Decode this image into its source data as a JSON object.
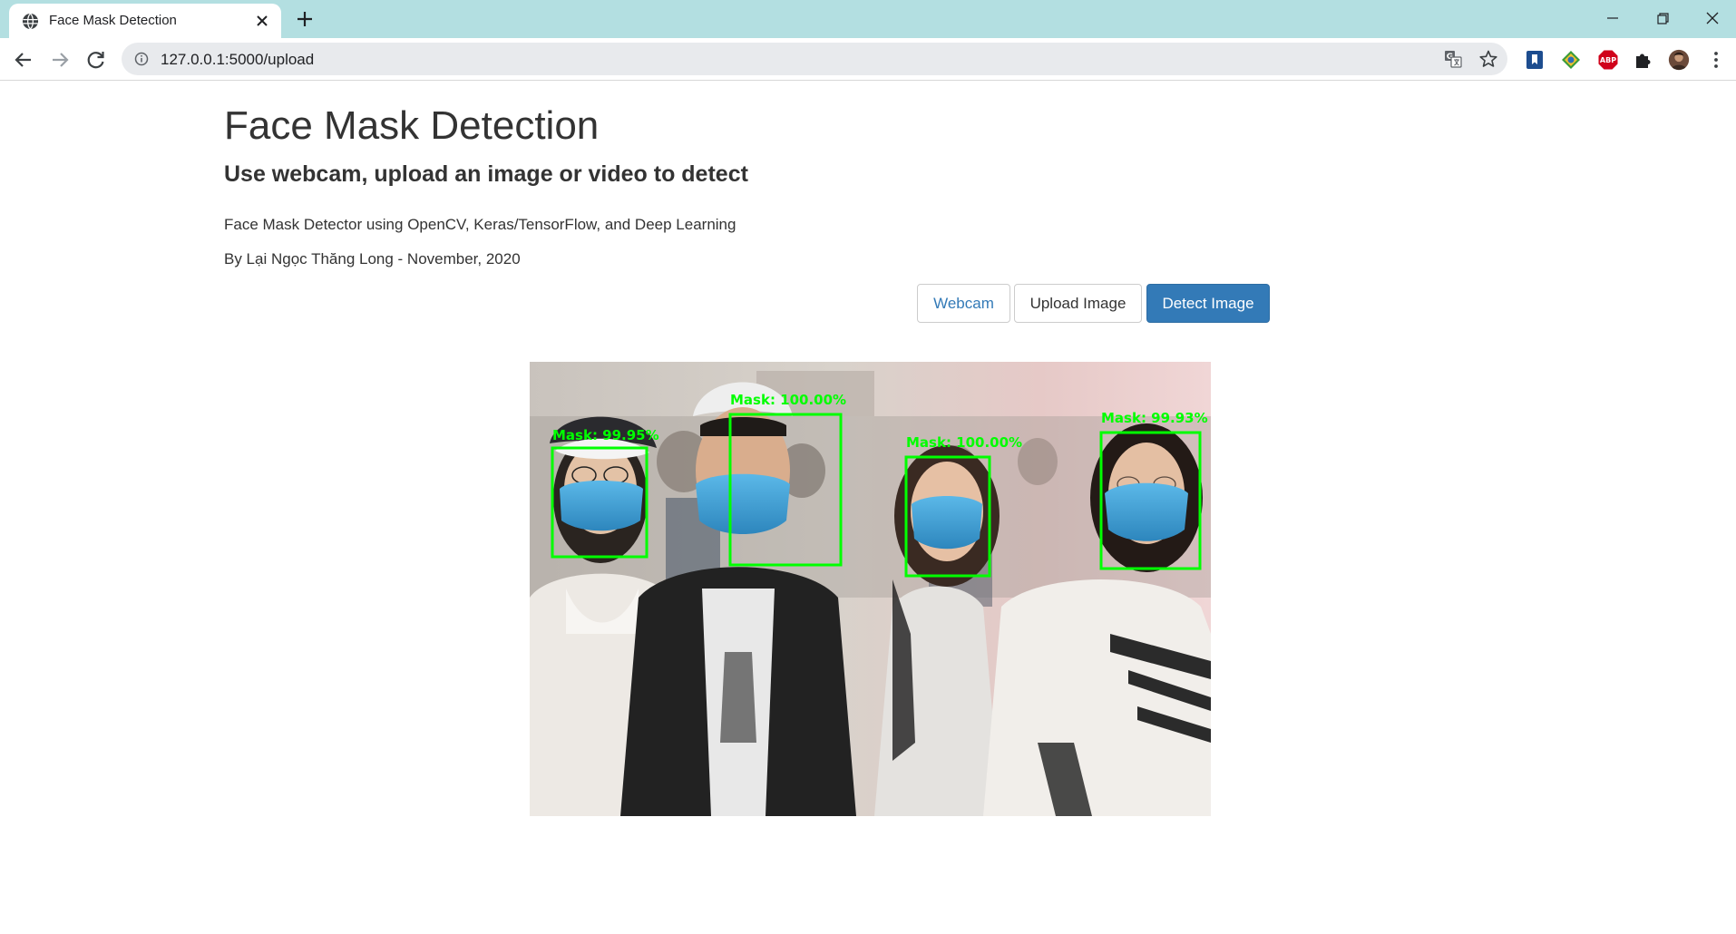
{
  "browser": {
    "tab_title": "Face Mask Detection",
    "url": "127.0.0.1:5000/upload",
    "icons": {
      "favicon": "globe-icon",
      "tab_close": "close-icon",
      "new_tab": "plus-icon",
      "back": "arrow-left-icon",
      "forward": "arrow-right-icon",
      "reload": "reload-icon",
      "site_info": "info-icon",
      "translate": "translate-icon",
      "bookmark": "star-icon",
      "extensions": [
        "bookmark-extension-icon",
        "globe-extension-icon",
        "adblock-icon",
        "puzzle-icon",
        "profile-avatar-icon"
      ],
      "menu": "kebab-menu-icon",
      "minimize": "minimize-icon",
      "restore": "restore-icon",
      "close": "window-close-icon"
    },
    "adblock_text": "ABP"
  },
  "page": {
    "title": "Face Mask Detection",
    "subtitle": "Use webcam, upload an image or video to detect",
    "description": "Face Mask Detector using OpenCV, Keras/TensorFlow, and Deep Learning",
    "author_line": "By Lại Ngọc Thăng Long - November, 2020",
    "buttons": {
      "webcam": "Webcam",
      "upload": "Upload Image",
      "detect": "Detect Image"
    }
  },
  "result": {
    "detections": [
      {
        "label": "Mask: 99.95%"
      },
      {
        "label": "Mask: 100.00%"
      },
      {
        "label": "Mask: 100.00%"
      },
      {
        "label": "Mask: 99.93%"
      }
    ]
  },
  "colors": {
    "tabstrip": "#b3dfe1",
    "primary": "#337ab7",
    "detection_box": "#00ff00",
    "mask": "#3ea3d6"
  }
}
